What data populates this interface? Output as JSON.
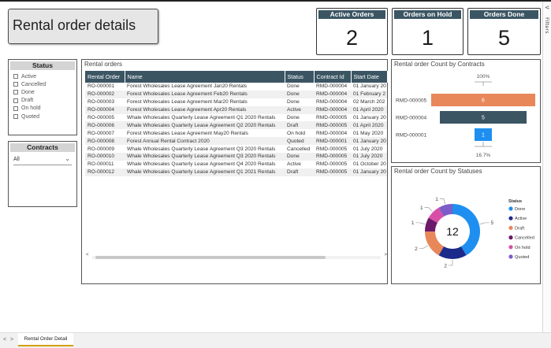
{
  "page": {
    "title": "Rental order details"
  },
  "filters_pane": {
    "label": "Filters",
    "chevron": "<"
  },
  "kpis": [
    {
      "label": "Active Orders",
      "value": "2"
    },
    {
      "label": "Orders on Hold",
      "value": "1"
    },
    {
      "label": "Orders Done",
      "value": "5"
    }
  ],
  "status_slicer": {
    "title": "Status",
    "options": [
      "Active",
      "Cancelled",
      "Done",
      "Draft",
      "On hold",
      "Quoted"
    ]
  },
  "contracts_slicer": {
    "title": "Contracts",
    "selected": "All"
  },
  "rental_orders": {
    "title": "Rental orders",
    "columns": [
      "Rental Order",
      "Name",
      "Status",
      "Contract Id",
      "Start Date"
    ],
    "rows": [
      [
        "RO-000001",
        "Forest Wholesales Lease Agreement Jan20 Rentals",
        "Done",
        "RMD-000004",
        "01 January 20"
      ],
      [
        "RO-000002",
        "Forest Wholesales Lease Agreement Feb20 Rentals",
        "Done",
        "RMD-000004",
        "01 February 2"
      ],
      [
        "RO-000003",
        "Forest Wholesales Lease Agreement Mar20 Rentals",
        "Done",
        "RMD-000004",
        "02 March 202"
      ],
      [
        "RO-000004",
        "Forest Wholesales Lease Agreement Apr20 Rentals",
        "Active",
        "RMD-000004",
        "01 April 2020"
      ],
      [
        "RO-000005",
        "Whale Wholesales Quarterly Lease Agreement Q1 2020 Rentals",
        "Done",
        "RMD-000005",
        "01 January 20"
      ],
      [
        "RO-000006",
        "Whale Wholesales Quarterly Lease Agreement Q2 2020 Rentals",
        "Draft",
        "RMD-000005",
        "01 April 2020"
      ],
      [
        "RO-000007",
        "Forest Wholesales Lease Agreement May20 Rentals",
        "On hold",
        "RMD-000004",
        "01 May 2020"
      ],
      [
        "RO-000008",
        "Forest Annual Rental Contract 2020",
        "Quoted",
        "RMD-000001",
        "01 January 20"
      ],
      [
        "RO-000009",
        "Whale Wholesales Quarterly Lease Agreement Q3 2020 Rentals",
        "Cancelled",
        "RMD-000005",
        "01 July 2020"
      ],
      [
        "RO-000010",
        "Whale Wholesales Quarterly Lease Agreement Q3 2020 Rentals",
        "Done",
        "RMD-000005",
        "01 July 2020"
      ],
      [
        "RO-000011",
        "Whale Wholesales Quarterly Lease Agreement Q4 2020 Rentals",
        "Active",
        "RMD-000005",
        "01 October 20"
      ],
      [
        "RO-000012",
        "Whale Wholesales Quarterly Lease Agreement Q1 2021 Rentals",
        "Draft",
        "RMD-000005",
        "01 January 20"
      ]
    ],
    "scroll_left": "<",
    "scroll_right": ">",
    "horizontal_scroll_fraction": 0.8
  },
  "funnel": {
    "title": "Rental order Count by Contracts",
    "top_pct": "100%",
    "bottom_pct": "16.7%"
  },
  "donut": {
    "title": "Rental order Count by Statuses",
    "center": "12",
    "legend_title": "Status"
  },
  "bottom_bar": {
    "tab_label": "Rental Order Detail",
    "nav_prev": "<",
    "nav_next": ">"
  },
  "colors": {
    "header": "#3b5563",
    "funnel": [
      "#e8875a",
      "#3b5563",
      "#1e8ff0"
    ],
    "donut": {
      "Done": "#1e8ff0",
      "Active": "#1c2a8a",
      "Draft": "#e8875a",
      "Cancelled": "#6b1a6b",
      "On hold": "#d94fa8",
      "Quoted": "#7b5cc8"
    }
  },
  "chart_data": [
    {
      "type": "bar",
      "orientation": "horizontal-funnel",
      "title": "Rental order Count by Contracts",
      "categories": [
        "RMD-000005",
        "RMD-000004",
        "RMD-000001"
      ],
      "values": [
        6,
        5,
        1
      ],
      "conversion_labels": {
        "top": "100%",
        "bottom": "16.7%"
      }
    },
    {
      "type": "pie",
      "subtype": "donut",
      "title": "Rental order Count by Statuses",
      "categories": [
        "Done",
        "Active",
        "Draft",
        "Cancelled",
        "On hold",
        "Quoted"
      ],
      "values": [
        5,
        2,
        2,
        1,
        1,
        1
      ],
      "total": 12,
      "legend_title": "Status",
      "legend_position": "right"
    }
  ]
}
